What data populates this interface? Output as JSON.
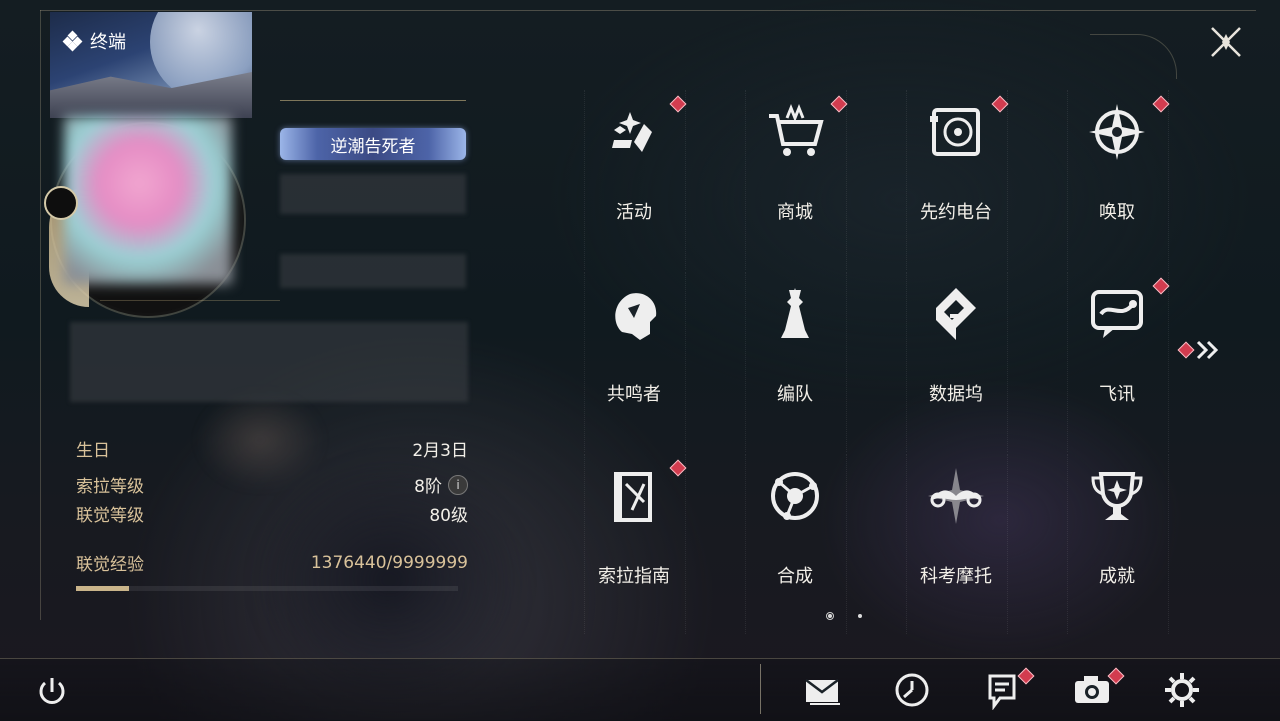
{
  "header": {
    "title": "终端",
    "title_icon": "diamond-cluster-icon",
    "close_icon": "close-x-icon"
  },
  "profile": {
    "badge_name": "逆潮告死者",
    "birthday": {
      "label": "生日",
      "value": "2月3日"
    },
    "sola_level": {
      "label": "索拉等级",
      "value": "8阶",
      "info_icon": "info-icon"
    },
    "union_level": {
      "label": "联觉等级",
      "value": "80级"
    },
    "union_exp": {
      "label": "联觉经验",
      "value": "1376440/9999999",
      "progress": 0.138
    }
  },
  "menu": {
    "items": [
      {
        "label": "活动",
        "icon": "activity-sparkle-icon",
        "badge": true
      },
      {
        "label": "商城",
        "icon": "shop-cart-icon",
        "badge": true
      },
      {
        "label": "先约电台",
        "icon": "radio-icon",
        "badge": true
      },
      {
        "label": "唤取",
        "icon": "summon-compass-icon",
        "badge": true
      },
      {
        "label": "共鸣者",
        "icon": "resonator-head-icon",
        "badge": false
      },
      {
        "label": "编队",
        "icon": "team-chess-icon",
        "badge": false
      },
      {
        "label": "数据坞",
        "icon": "data-dock-icon",
        "badge": false
      },
      {
        "label": "飞讯",
        "icon": "message-icon",
        "badge": true
      },
      {
        "label": "索拉指南",
        "icon": "guide-book-icon",
        "badge": true
      },
      {
        "label": "合成",
        "icon": "synthesis-icon",
        "badge": false
      },
      {
        "label": "科考摩托",
        "icon": "motorcycle-icon",
        "badge": false
      },
      {
        "label": "成就",
        "icon": "trophy-icon",
        "badge": false
      }
    ],
    "next_page_icon": "double-chevron-right-icon",
    "page_count": 2,
    "current_page": 1
  },
  "bottom_bar": {
    "power_icon": "power-icon",
    "buttons": [
      {
        "icon": "mail-icon",
        "badge": false
      },
      {
        "icon": "clock-icon",
        "badge": false
      },
      {
        "icon": "notice-icon",
        "badge": true
      },
      {
        "icon": "camera-icon",
        "badge": true
      },
      {
        "icon": "settings-gear-icon",
        "badge": false
      }
    ]
  },
  "colors": {
    "accent_gold": "#d9c29a",
    "badge_red": "#d23c4f",
    "text": "#f2efe8"
  }
}
